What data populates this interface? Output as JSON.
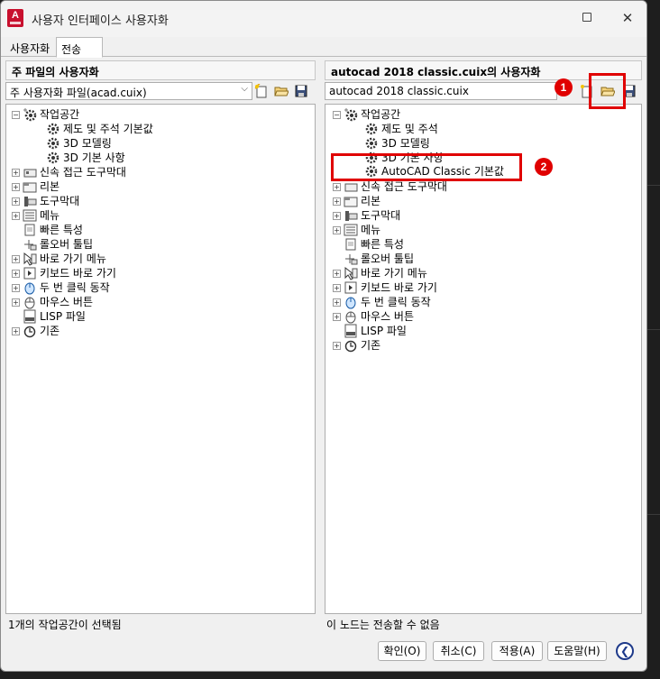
{
  "window": {
    "title": "사용자 인터페이스 사용자화",
    "app_icon": "A"
  },
  "tabs": [
    {
      "label": "사용자화"
    },
    {
      "label": "전송"
    }
  ],
  "left": {
    "title": "주 파일의 사용자화",
    "combo_value": "주 사용자화 파일(acad.cuix)",
    "workspace": "작업공간",
    "workspace_children": [
      "제도 및 주석 기본값",
      "3D 모델링",
      "3D 기본 사항"
    ],
    "items": [
      "신속 접근 도구막대",
      "리본",
      "도구막대",
      "메뉴",
      "빠른 특성",
      "롤오버 툴팁",
      "바로 가기 메뉴",
      "키보드 바로 가기",
      "두 번 클릭 동작",
      "마우스 버튼",
      "LISP 파일",
      "기존"
    ],
    "status": "1개의 작업공간이 선택됨"
  },
  "right": {
    "title": "autocad 2018 classic.cuix의 사용자화",
    "combo_value": "autocad 2018 classic.cuix",
    "workspace": "작업공간",
    "workspace_children": [
      "제도 및 주석",
      "3D 모델링",
      "3D 기본 사항",
      "AutoCAD Classic 기본값"
    ],
    "items": [
      "신속 접근 도구막대",
      "리본",
      "도구막대",
      "메뉴",
      "빠른 특성",
      "롤오버 툴팁",
      "바로 가기 메뉴",
      "키보드 바로 가기",
      "두 번 클릭 동작",
      "마우스 버튼",
      "LISP 파일",
      "기존"
    ],
    "status": "이 노드는 전송할 수 없음"
  },
  "buttons": {
    "ok": "확인(O)",
    "cancel": "취소(C)",
    "apply": "적용(A)",
    "help": "도움말(H)"
  },
  "annotations": {
    "badge1": "1",
    "badge2": "2"
  }
}
